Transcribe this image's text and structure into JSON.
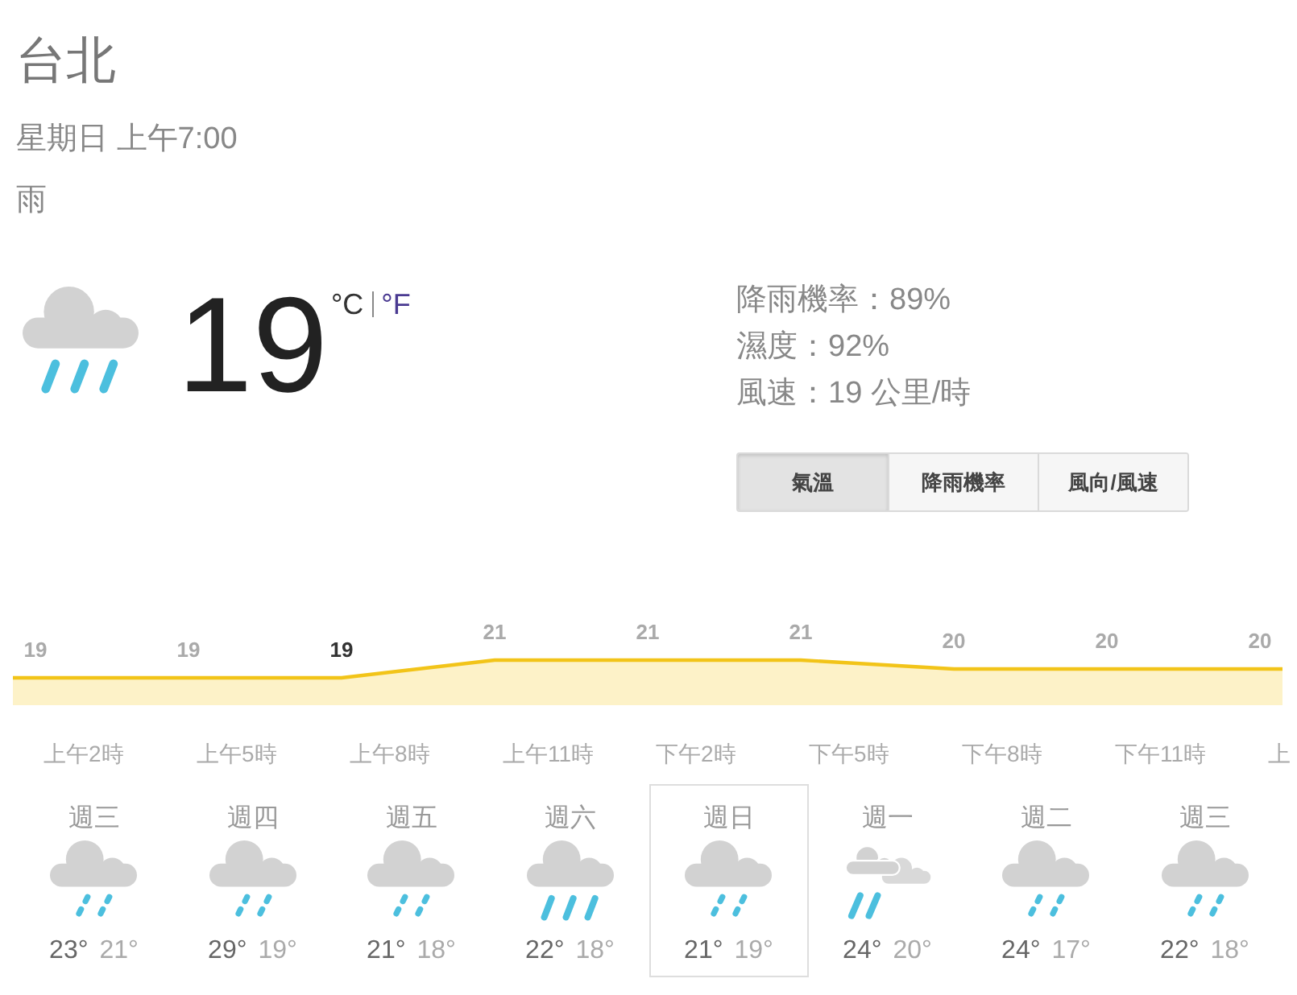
{
  "location": {
    "city": "台北",
    "datetime": "星期日 上午7:00",
    "condition": "雨"
  },
  "current": {
    "temperature": "19",
    "units": [
      {
        "label": "°C",
        "selected": true
      },
      {
        "label": "°F",
        "selected": false
      }
    ]
  },
  "details": [
    "降雨機率：89%",
    "濕度：92%",
    "風速：19 公里/時"
  ],
  "tabs": [
    {
      "label": "氣溫",
      "selected": true
    },
    {
      "label": "降雨機率",
      "selected": false
    },
    {
      "label": "風向/風速",
      "selected": false
    }
  ],
  "hourly": {
    "points": [
      {
        "temperature": "19",
        "selected": false
      },
      {
        "temperature": "19",
        "selected": false
      },
      {
        "temperature": "19",
        "selected": true
      },
      {
        "temperature": "21",
        "selected": false
      },
      {
        "temperature": "21",
        "selected": false
      },
      {
        "temperature": "21",
        "selected": false
      },
      {
        "temperature": "20",
        "selected": false
      },
      {
        "temperature": "20",
        "selected": false
      },
      {
        "temperature": "20",
        "selected": false
      }
    ],
    "times": [
      "上午2時",
      "上午5時",
      "上午8時",
      "上午11時",
      "下午2時",
      "下午5時",
      "下午8時",
      "下午11時",
      "上"
    ]
  },
  "days": [
    {
      "day": "週三",
      "kind": "light_rain",
      "high": "23°",
      "low": "21°",
      "selected": false
    },
    {
      "day": "週四",
      "kind": "light_rain",
      "high": "29°",
      "low": "19°",
      "selected": false
    },
    {
      "day": "週五",
      "kind": "light_rain",
      "high": "21°",
      "low": "18°",
      "selected": false
    },
    {
      "day": "週六",
      "kind": "rain",
      "high": "22°",
      "low": "18°",
      "selected": false
    },
    {
      "day": "週日",
      "kind": "light_rain",
      "high": "21°",
      "low": "19°",
      "selected": true
    },
    {
      "day": "週一",
      "kind": "showers",
      "high": "24°",
      "low": "20°",
      "selected": false
    },
    {
      "day": "週二",
      "kind": "light_rain",
      "high": "24°",
      "low": "17°",
      "selected": false
    },
    {
      "day": "週三",
      "kind": "light_rain",
      "high": "22°",
      "low": "18°",
      "selected": false
    }
  ]
}
